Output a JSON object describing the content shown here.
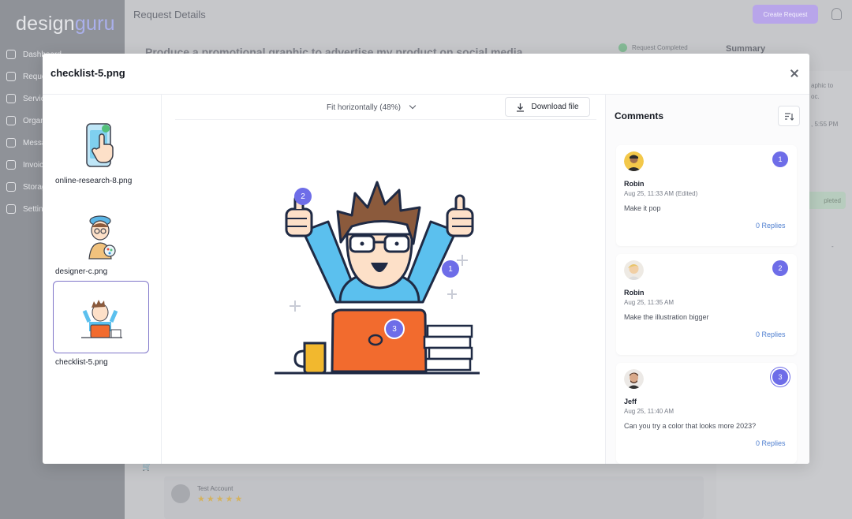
{
  "app": {
    "logo_part1": "design",
    "logo_part2": "guru",
    "header_title": "Request Details",
    "create_button": "Create Request",
    "request_heading": "Produce a promotional graphic to advertise my product on social media",
    "status": "Request Completed",
    "summary_title": "Summary",
    "summary_fragments": [
      "aphic to",
      "oc.",
      ", 5:55 PM",
      "pleted",
      "-"
    ],
    "review_account": "Test Account",
    "review_stars": "★★★★★",
    "nav": [
      "Dashboard",
      "Requests",
      "Services",
      "Organizations",
      "Messages",
      "Invoices",
      "Storage",
      "Settings"
    ]
  },
  "modal": {
    "title": "checklist-5.png",
    "zoom_label": "Fit horizontally (48%)",
    "download_label": "Download file",
    "thumbnails": [
      {
        "label": "online-research-8.png",
        "icon": "phone-tap-icon",
        "selected": false
      },
      {
        "label": "designer-c.png",
        "icon": "designer-avatar-icon",
        "selected": false
      },
      {
        "label": "checklist-5.png",
        "icon": "checklist-illustration-icon",
        "selected": true
      }
    ],
    "markers": [
      "1",
      "2",
      "3"
    ]
  },
  "comments": {
    "title": "Comments",
    "items": [
      {
        "number": "1",
        "author": "Robin",
        "time": "Aug 25, 11:33 AM (Edited)",
        "text": "Make it pop",
        "replies": "0 Replies"
      },
      {
        "number": "2",
        "author": "Robin",
        "time": "Aug 25, 11:35 AM",
        "text": "Make the illustration bigger",
        "replies": "0 Replies"
      },
      {
        "number": "3",
        "author": "Jeff",
        "time": "Aug 25, 11:40 AM",
        "text": "Can you try a color that looks more 2023?",
        "replies": "0 Replies"
      }
    ]
  },
  "colors": {
    "accent": "#6e6de8",
    "selected_border": "#7f75c9",
    "link": "#4f7fd0",
    "laptop": "#f26b2e",
    "shirt": "#5bc0ee",
    "hair": "#8b5a3c",
    "mug": "#f2b82e"
  }
}
